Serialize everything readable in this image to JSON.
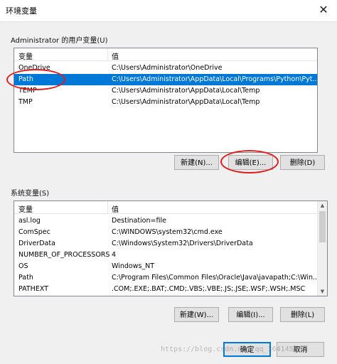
{
  "window": {
    "title": "环境变量",
    "close_glyph": "✕"
  },
  "user_section": {
    "label": "Administrator 的用户变量(U)",
    "columns": [
      "变量",
      "值"
    ],
    "rows": [
      {
        "name": "OneDrive",
        "value": "C:\\Users\\Administrator\\OneDrive"
      },
      {
        "name": "Path",
        "value": "C:\\Users\\Administrator\\AppData\\Local\\Programs\\Python\\Pyt..."
      },
      {
        "name": "TEMP",
        "value": "C:\\Users\\Administrator\\AppData\\Local\\Temp"
      },
      {
        "name": "TMP",
        "value": "C:\\Users\\Administrator\\AppData\\Local\\Temp"
      }
    ],
    "selected_index": 1,
    "buttons": {
      "new": "新建(N)...",
      "edit": "编辑(E)...",
      "delete": "删除(D)"
    }
  },
  "system_section": {
    "label": "系统变量(S)",
    "columns": [
      "变量",
      "值"
    ],
    "rows": [
      {
        "name": "asl.log",
        "value": "Destination=file"
      },
      {
        "name": "ComSpec",
        "value": "C:\\WINDOWS\\system32\\cmd.exe"
      },
      {
        "name": "DriverData",
        "value": "C:\\Windows\\System32\\Drivers\\DriverData"
      },
      {
        "name": "NUMBER_OF_PROCESSORS",
        "value": "4"
      },
      {
        "name": "OS",
        "value": "Windows_NT"
      },
      {
        "name": "Path",
        "value": "C:\\Program Files\\Common Files\\Oracle\\Java\\javapath;C:\\Win..."
      },
      {
        "name": "PATHEXT",
        "value": ".COM;.EXE;.BAT;.CMD;.VBS;.VBE;.JS;.JSE;.WSF;.WSH;.MSC"
      }
    ],
    "buttons": {
      "new": "新建(W)...",
      "edit": "编辑(I)...",
      "delete": "删除(L)"
    }
  },
  "footer": {
    "ok": "确定",
    "cancel": "取消"
  },
  "watermark": "https://blog.csdn.net/qq_36414588",
  "colors": {
    "selection": "#0078d7",
    "annotation": "#e41c1c"
  }
}
